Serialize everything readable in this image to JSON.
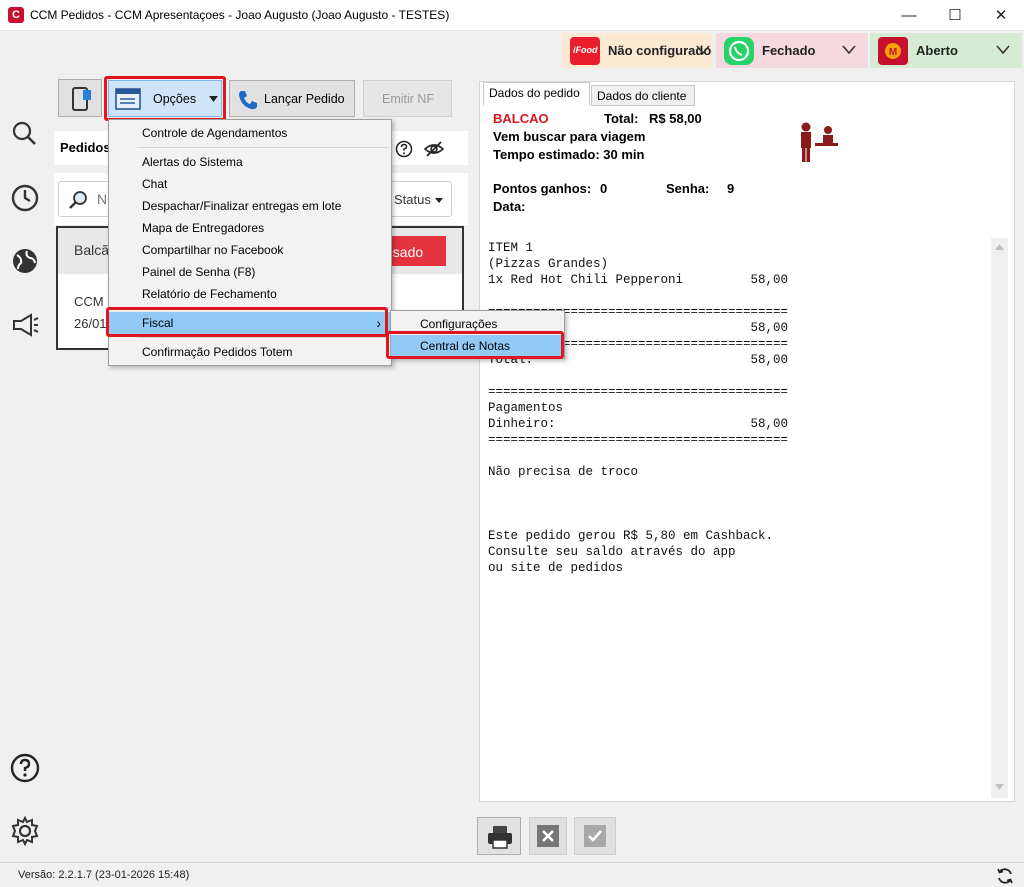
{
  "window": {
    "title": "CCM Pedidos - CCM Apresentaçoes - Joao Augusto (Joao Augusto - TESTES)",
    "minimize": "—",
    "maximize": "☐",
    "close": "✕"
  },
  "status_cards": [
    {
      "brand": "ifood",
      "label": "Não configurado",
      "color": "#fde9d2",
      "logo_color": "#ea1d2c"
    },
    {
      "brand": "whatsapp",
      "label": "Fechado",
      "color": "#f6d9de",
      "logo_color": "#25d366"
    },
    {
      "brand": "ccm",
      "label": "Aberto",
      "color": "#d6ebd4",
      "logo_color": "#c8102e"
    }
  ],
  "toolbar": {
    "opcoes_label": "Opções",
    "lancar_pedido_label": "Lançar Pedido",
    "emitir_nf_label": "Emitir NF"
  },
  "orders_panel": {
    "header": "Pedidos",
    "search_placeholder": "N",
    "status_filter": "Status",
    "card_title": "Balcã",
    "card_badge": "usado",
    "card_line1": "CCM",
    "card_line2": "26/01"
  },
  "menu": {
    "items": [
      "Controle de Agendamentos",
      "Alertas do Sistema",
      "Chat",
      "Despachar/Finalizar entregas em lote",
      "Mapa de Entregadores",
      "Compartilhar no Facebook",
      "Painel de Senha (F8)",
      "Relatório de Fechamento",
      "Fiscal",
      "Confirmação Pedidos Totem"
    ],
    "fiscal_arrow": "›",
    "submenu": [
      "Configurações",
      "Central de Notas"
    ]
  },
  "order_detail": {
    "tabs": [
      "Dados do pedido",
      "Dados do cliente"
    ],
    "type": "BALCAO",
    "total_label": "Total:",
    "total_value": "R$ 58,00",
    "line_pickup": "Vem buscar para viagem",
    "line_time": "Tempo estimado: 30 min",
    "points_label": "Pontos ganhos:",
    "points_value": "0",
    "senha_label": "Senha:",
    "senha_value": "9",
    "data_label": "Data:",
    "receipt": "ITEM 1\n(Pizzas Grandes)\n1x Red Hot Chili Pepperoni         58,00\n\n========================================\n                                   58,00\n========================================\nTotal:                             58,00\n\n========================================\nPagamentos\nDinheiro:                          58,00\n========================================\n\nNão precisa de troco\n\n\n\nEste pedido gerou R$ 5,80 em Cashback.\nConsulte seu saldo através do app\nou site de pedidos"
  },
  "footer": {
    "version": "Versão: 2.2.1.7 (23-01-2026 15:48)"
  },
  "colors": {
    "highlight": "#e0151f",
    "menu_selected": "#91c9f7",
    "badge_red": "#e5323f",
    "balcao_red": "#e0151f"
  }
}
